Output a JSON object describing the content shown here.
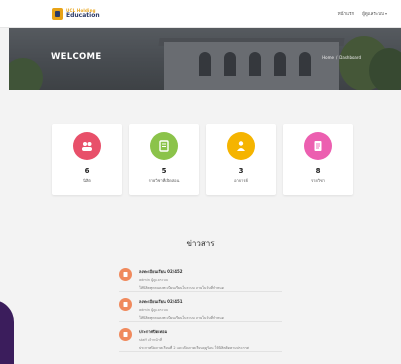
{
  "brand": {
    "top": "UCL Holding",
    "bottom": "Education"
  },
  "nav": {
    "link": "หน้าแรก",
    "user": "ผู้ดูแลระบบ"
  },
  "hero": {
    "title": "WELCOME",
    "crumb_home": "Home",
    "crumb_sep": "/",
    "crumb_current": "Dashboard"
  },
  "cards": [
    {
      "count": "6",
      "label": "นิสิต",
      "icon": "people-icon",
      "color": "#e8506a"
    },
    {
      "count": "5",
      "label": "รายวิชาที่เปิดสอน",
      "icon": "book-icon",
      "color": "#8bc34a"
    },
    {
      "count": "3",
      "label": "อาจารย์",
      "icon": "teacher-icon",
      "color": "#f5b400"
    },
    {
      "count": "8",
      "label": "รายวิชา",
      "icon": "document-icon",
      "color": "#ec5fb0"
    }
  ],
  "news": {
    "title": "ข่าวสาร",
    "items": [
      {
        "head": "ลงทะเบียนเรียน 02/452",
        "sub": "admin ผู้ดูแลระบบ",
        "desc": "ให้นิสิตทุกคนลงทะเบียนเรียนในระบบ ภายในวันที่กำหนด"
      },
      {
        "head": "ลงทะเบียนเรียน 02/451",
        "sub": "admin ผู้ดูแลระบบ",
        "desc": "ให้นิสิตทุกคนลงทะเบียนเรียนในระบบ ภายในวันที่กำหนด"
      },
      {
        "head": "ประกาศปิดเทอม",
        "sub": "staff เจ้าหน้าที่",
        "desc": "ประกาศปิดภาคเรียนที่ 2 และเปิดภาคเรียนฤดูร้อน ให้นิสิตติดตามประกาศ"
      }
    ]
  }
}
